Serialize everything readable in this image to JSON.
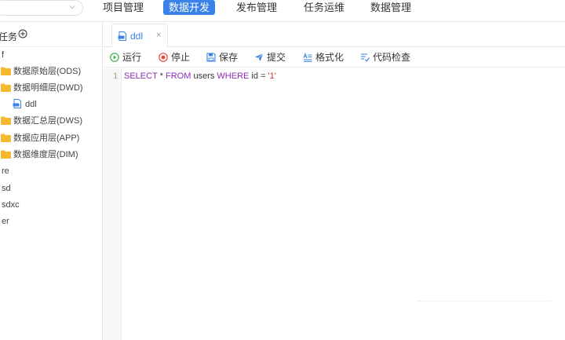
{
  "nav": {
    "items": [
      {
        "label": "项目管理",
        "active": false
      },
      {
        "label": "数据开发",
        "active": true
      },
      {
        "label": "发布管理",
        "active": false
      },
      {
        "label": "任务运维",
        "active": false
      },
      {
        "label": "数据管理",
        "active": false
      }
    ]
  },
  "sidebar": {
    "title": "任务",
    "tree": [
      {
        "label": "f",
        "type": "task"
      },
      {
        "label": "数据原始层(ODS)",
        "type": "folder"
      },
      {
        "label": "数据明细层(DWD)",
        "type": "folder"
      },
      {
        "label": "ddl",
        "type": "file"
      },
      {
        "label": "数据汇总层(DWS)",
        "type": "folder"
      },
      {
        "label": "数据应用层(APP)",
        "type": "folder"
      },
      {
        "label": "数据维度层(DIM)",
        "type": "folder"
      },
      {
        "label": "re",
        "type": "task"
      },
      {
        "label": "sd",
        "type": "task"
      },
      {
        "label": "sdxc",
        "type": "task"
      },
      {
        "label": "er",
        "type": "task"
      }
    ]
  },
  "editor": {
    "tab": {
      "label": "ddl",
      "close": "×"
    },
    "toolbar": {
      "run": "运行",
      "stop": "停止",
      "save": "保存",
      "submit": "提交",
      "format": "格式化",
      "check": "代码检查"
    },
    "line_number": "1",
    "code": {
      "select": "SELECT",
      "star": " * ",
      "from": "FROM",
      "table": " users ",
      "where": "WHERE",
      "cond": " id = ",
      "value": "'1'"
    }
  },
  "colors": {
    "accent": "#3a82e8",
    "folder": "#f5b82e",
    "run": "#3dae4a",
    "stop": "#e84545",
    "keyword": "#8b2bb9",
    "string": "#c0392b"
  }
}
